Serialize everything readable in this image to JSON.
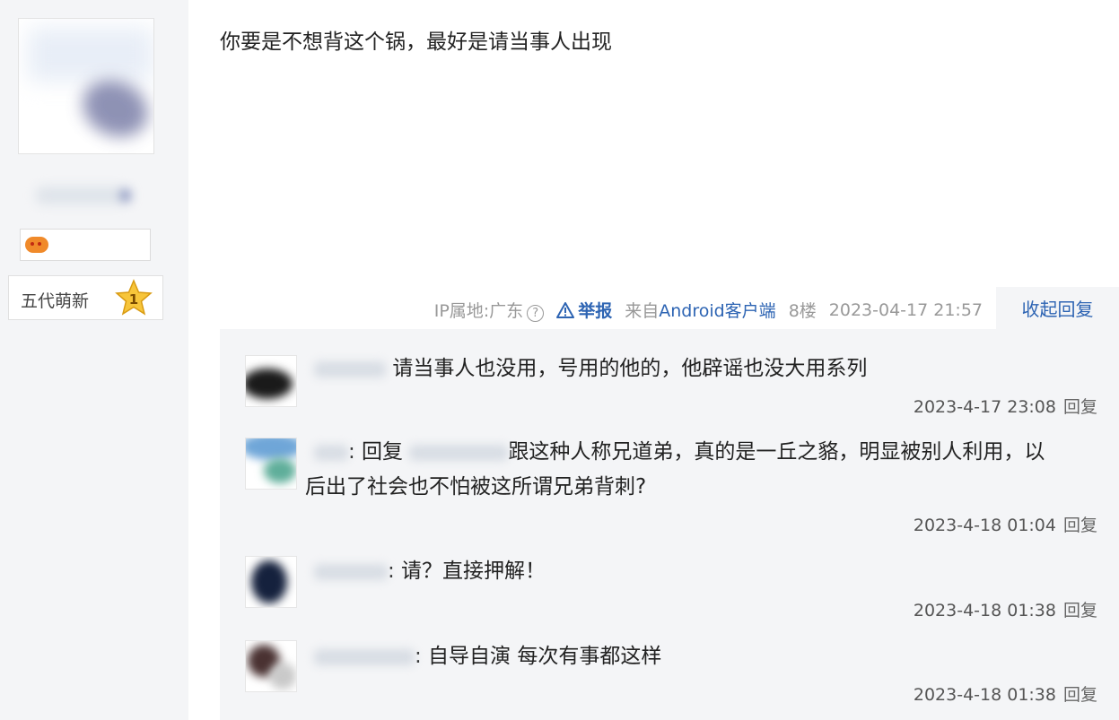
{
  "user": {
    "badge_icon": "gamepad-icon",
    "level_title": "五代萌新",
    "level_number": "1"
  },
  "post": {
    "content": "你要是不想背这个锅，最好是请当事人出现",
    "ip_label": "IP属地:广东",
    "help_icon": "?",
    "report_label": "举报",
    "source_prefix": "来自",
    "source_client": "Android客户端",
    "floor": "8楼",
    "datetime": "2023-04-17 21:57",
    "collapse_label": "收起回复"
  },
  "replies": [
    {
      "text": "请当事人也没用，号用的他的，他辟谣也没大用系列",
      "time": "2023-4-17 23:08",
      "reply_label": "回复"
    },
    {
      "prefix": ": 回复",
      "text_line1": "跟这种人称兄道弟，真的是一丘之貉，明显被别人利用，以",
      "text_line2": "后出了社会也不怕被这所谓兄弟背刺?",
      "time": "2023-4-18 01:04",
      "reply_label": "回复"
    },
    {
      "text": ": 请？直接押解！",
      "time": "2023-4-18 01:38",
      "reply_label": "回复"
    },
    {
      "text": ": 自导自演 每次有事都这样",
      "time": "2023-4-18 01:38",
      "reply_label": "回复"
    }
  ],
  "colors": {
    "link": "#2d64b3",
    "reply_bg": "#f4f5f7",
    "meta_gray": "#999999"
  }
}
